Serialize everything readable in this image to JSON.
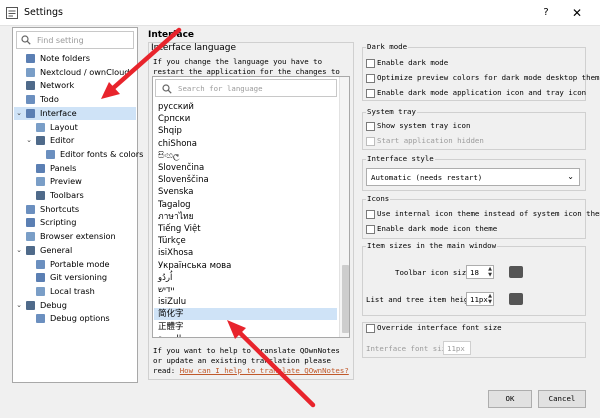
{
  "window": {
    "title": "Settings",
    "help_label": "?",
    "close_label": "✕"
  },
  "nav": {
    "search_placeholder": "Find setting",
    "items": [
      {
        "label": "Note folders",
        "icon": "folder-icon",
        "depth": 1,
        "arrow": ""
      },
      {
        "label": "Nextcloud / ownCloud",
        "icon": "cloud-icon",
        "depth": 1,
        "arrow": ""
      },
      {
        "label": "Network",
        "icon": "network-icon",
        "depth": 1,
        "arrow": ""
      },
      {
        "label": "Todo",
        "icon": "todo-icon",
        "depth": 1,
        "arrow": ""
      },
      {
        "label": "Interface",
        "icon": "interface-icon",
        "depth": 1,
        "arrow": "⌄",
        "selected": true
      },
      {
        "label": "Layout",
        "icon": "layout-icon",
        "depth": 2,
        "arrow": ""
      },
      {
        "label": "Editor",
        "icon": "editor-icon",
        "depth": 2,
        "arrow": "⌄"
      },
      {
        "label": "Editor fonts & colors",
        "icon": "font-icon",
        "depth": 3,
        "arrow": ""
      },
      {
        "label": "Panels",
        "icon": "panels-icon",
        "depth": 2,
        "arrow": ""
      },
      {
        "label": "Preview",
        "icon": "preview-icon",
        "depth": 2,
        "arrow": ""
      },
      {
        "label": "Toolbars",
        "icon": "toolbars-icon",
        "depth": 2,
        "arrow": ""
      },
      {
        "label": "Shortcuts",
        "icon": "keyboard-icon",
        "depth": 1,
        "arrow": ""
      },
      {
        "label": "Scripting",
        "icon": "script-icon",
        "depth": 1,
        "arrow": ""
      },
      {
        "label": "Browser extension",
        "icon": "browser-icon",
        "depth": 1,
        "arrow": ""
      },
      {
        "label": "General",
        "icon": "general-icon",
        "depth": 1,
        "arrow": "⌄"
      },
      {
        "label": "Portable mode",
        "icon": "portable-icon",
        "depth": 2,
        "arrow": ""
      },
      {
        "label": "Git versioning",
        "icon": "git-icon",
        "depth": 2,
        "arrow": ""
      },
      {
        "label": "Local trash",
        "icon": "trash-icon",
        "depth": 2,
        "arrow": ""
      },
      {
        "label": "Debug",
        "icon": "debug-icon",
        "depth": 1,
        "arrow": "⌄"
      },
      {
        "label": "Debug options",
        "icon": "debug-options-icon",
        "depth": 2,
        "arrow": ""
      }
    ]
  },
  "content": {
    "title": "Interface",
    "language": {
      "group_label": "Interface language",
      "description": "If you change the language you have to restart the application for the changes to take action.",
      "search_placeholder": "Search for language",
      "items": [
        "русский",
        "Српски",
        "Shqip",
        "chiShona",
        "සිංහල",
        "Slovenčina",
        "Slovenščina",
        "Svenska",
        "Tagalog",
        "ภาษาไทย",
        "Tiếng Việt",
        "Türkçe",
        "isiXhosa",
        "Українська мова",
        "اُردُو",
        "יידיש",
        "isiZulu",
        "简化字",
        "正體字",
        "العربية"
      ],
      "selected_index": 17,
      "help_text": "If you want to help to translate QOwnNotes or update an existing translation please read: ",
      "help_link": "How can I help to translate QOwnNotes?"
    },
    "dark_mode": {
      "group_label": "Dark mode",
      "options": [
        {
          "label": "Enable dark mode",
          "checked": false,
          "disabled": false
        },
        {
          "label": "Optimize preview colors for dark mode desktop themes",
          "checked": false,
          "disabled": false
        },
        {
          "label": "Enable dark mode application icon and tray icon",
          "checked": false,
          "disabled": false
        }
      ]
    },
    "system_tray": {
      "group_label": "System tray",
      "options": [
        {
          "label": "Show system tray icon",
          "checked": false,
          "disabled": false
        },
        {
          "label": "Start application hidden",
          "checked": false,
          "disabled": true
        }
      ]
    },
    "interface_style": {
      "group_label": "Interface style",
      "value": "Automatic (needs restart)"
    },
    "icons": {
      "group_label": "Icons",
      "options": [
        {
          "label": "Use internal icon theme instead of system icon theme",
          "checked": false,
          "disabled": false
        },
        {
          "label": "Enable dark mode icon theme",
          "checked": false,
          "disabled": false
        }
      ]
    },
    "item_sizes": {
      "group_label": "Item sizes in the main window",
      "toolbar_label": "Toolbar icon size:",
      "toolbar_value": "18",
      "list_label": "List and tree item height:",
      "list_value": "11px"
    },
    "font_override": {
      "checkbox_label": "Override interface font size",
      "size_label": "Interface font size:",
      "size_value": "11px"
    }
  },
  "buttons": {
    "ok": "OK",
    "cancel": "Cancel"
  },
  "colors": {
    "selection": "#cfe3f7",
    "annotation_arrow": "#e8242c",
    "link": "#c0592b"
  }
}
